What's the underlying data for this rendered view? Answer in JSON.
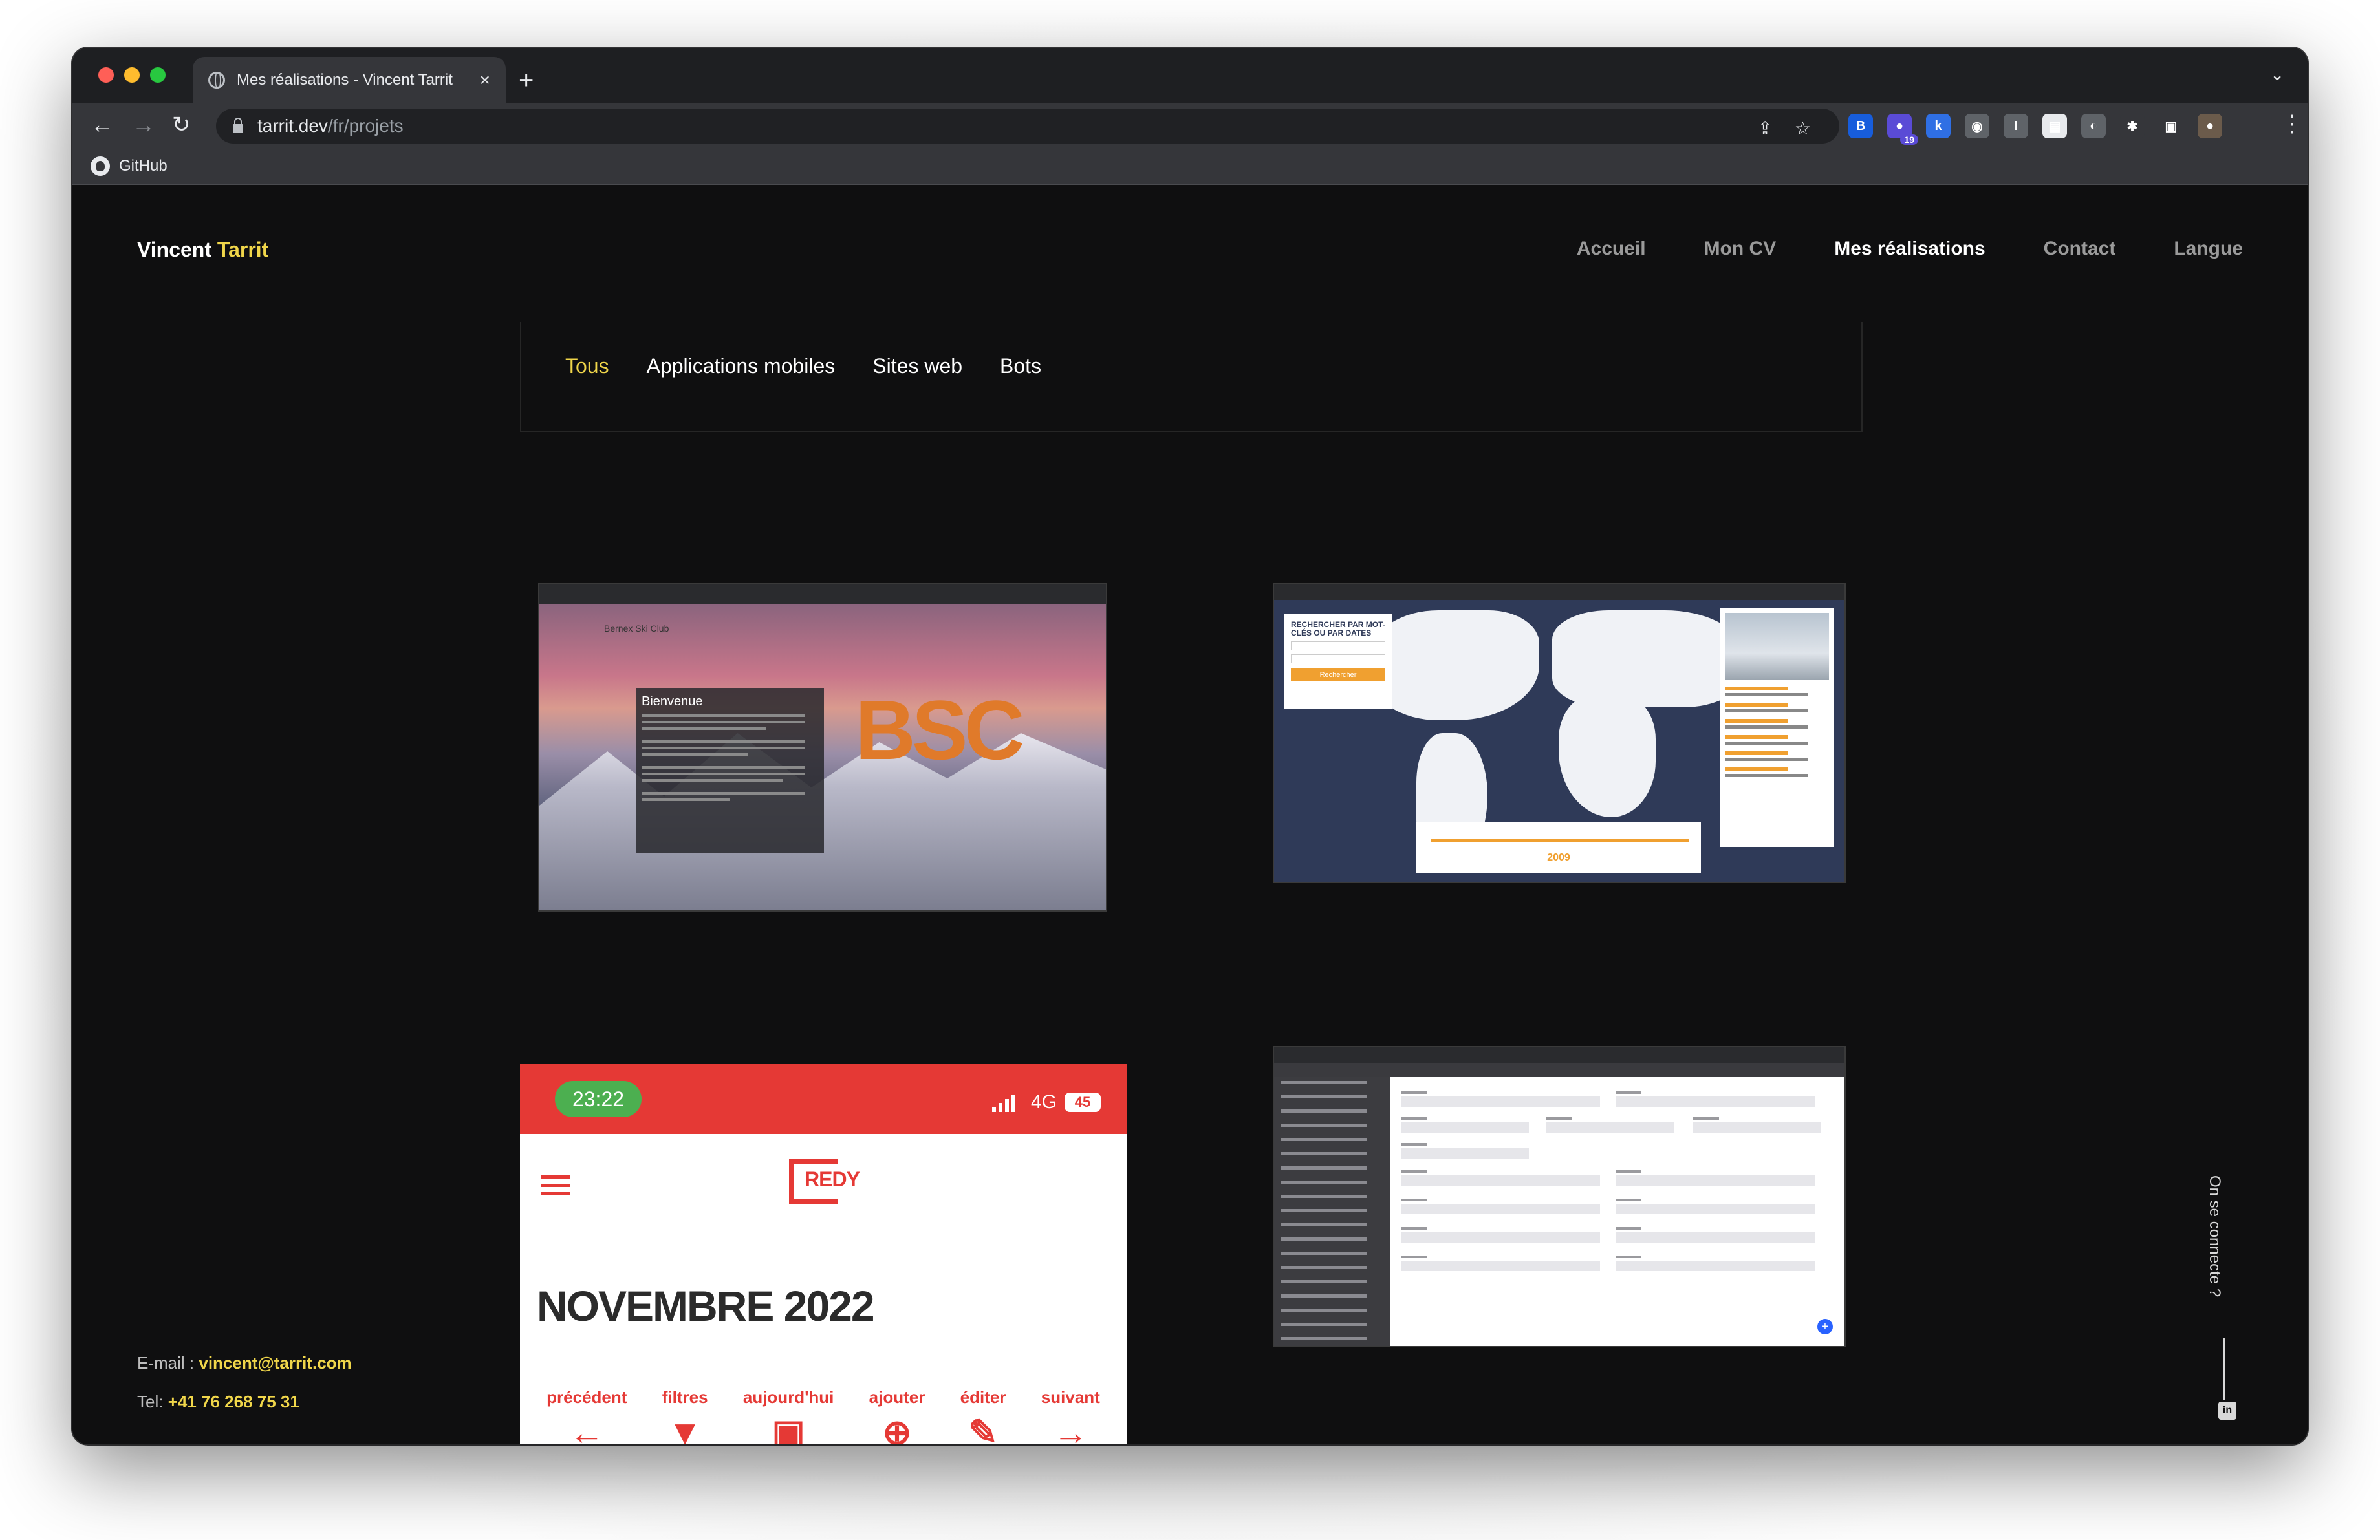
{
  "browser": {
    "tab_title": "Mes réalisations - Vincent Tarrit",
    "url_host": "tarrit.dev",
    "url_path": "/fr/projets",
    "bookmark": "GitHub",
    "extensions": [
      {
        "icon": "bitwarden-icon",
        "color": "#175ddc",
        "glyph": "B",
        "badge": ""
      },
      {
        "icon": "extension-purple-icon",
        "color": "#5a4bd6",
        "glyph": "●",
        "badge": "19"
      },
      {
        "icon": "k-icon",
        "color": "#2f6fe4",
        "glyph": "k",
        "badge": ""
      },
      {
        "icon": "camera-icon",
        "color": "#5f6368",
        "glyph": "◉",
        "badge": ""
      },
      {
        "icon": "info-icon",
        "color": "#5f6368",
        "glyph": "I",
        "badge": ""
      },
      {
        "icon": "document-icon",
        "color": "#e8eaed",
        "glyph": "▤",
        "badge": ""
      },
      {
        "icon": "globe-extension-icon",
        "color": "#5f6368",
        "glyph": "◐",
        "badge": ""
      },
      {
        "icon": "puzzle-icon",
        "color": "#35363a",
        "glyph": "✱",
        "badge": ""
      },
      {
        "icon": "side-panel-icon",
        "color": "#35363a",
        "glyph": "▣",
        "badge": ""
      },
      {
        "icon": "profile-avatar-icon",
        "color": "#6b5b4b",
        "glyph": "●",
        "badge": ""
      }
    ]
  },
  "site": {
    "brand_first": "Vincent",
    "brand_last": "Tarrit",
    "nav": [
      "Accueil",
      "Mon CV",
      "Mes réalisations",
      "Contact",
      "Langue"
    ],
    "active_nav": "Mes réalisations",
    "filters": [
      "Tous",
      "Applications mobiles",
      "Sites web",
      "Bots"
    ],
    "active_filter": "Tous",
    "accent_color": "#f0d64a"
  },
  "projects": {
    "bsc": {
      "site_name": "Bernex Ski Club",
      "dialog_title": "Bienvenue",
      "logo_text": "BSC"
    },
    "map": {
      "search_title": "RECHERCHER PAR MOT-CLÉS OU PAR DATES",
      "search_button": "Rechercher",
      "year": "2009"
    },
    "redy": {
      "time": "23:22",
      "network": "4G",
      "battery": "45",
      "logo": "REDY",
      "month": "NOVEMBRE 2022",
      "actions": [
        {
          "label": "précédent",
          "glyph": "←"
        },
        {
          "label": "filtres",
          "glyph": "▼"
        },
        {
          "label": "aujourd'hui",
          "glyph": "▣"
        },
        {
          "label": "ajouter",
          "glyph": "⊕"
        },
        {
          "label": "éditer",
          "glyph": "✎"
        },
        {
          "label": "suivant",
          "glyph": "→"
        }
      ]
    },
    "form_app": {
      "fab": "+"
    }
  },
  "contact": {
    "email_label": "E-mail :",
    "email": "vincent@tarrit.com",
    "tel_label": "Tel:",
    "tel": "+41 76 268 75 31"
  },
  "social": {
    "connect_text": "On se connecte ?",
    "linkedin": "in"
  }
}
